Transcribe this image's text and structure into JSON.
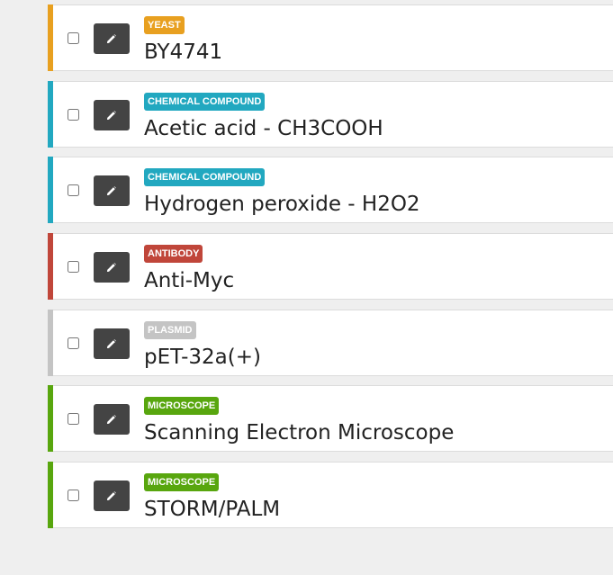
{
  "colors": {
    "yeast": "#e8a020",
    "chemical_compound": "#22a8c0",
    "antibody": "#c0463a",
    "plasmid": "#c4c4c4",
    "microscope": "#58a60e",
    "edit_button": "#444444"
  },
  "items": [
    {
      "category": "YEAST",
      "color": "#e8a020",
      "name": "BY4741",
      "checked": false,
      "edit_icon": "pencil-icon"
    },
    {
      "category": "CHEMICAL COMPOUND",
      "color": "#22a8c0",
      "name": "Acetic acid - CH3COOH",
      "checked": false,
      "edit_icon": "pencil-icon"
    },
    {
      "category": "CHEMICAL COMPOUND",
      "color": "#22a8c0",
      "name": "Hydrogen peroxide - H2O2",
      "checked": false,
      "edit_icon": "pencil-icon"
    },
    {
      "category": "ANTIBODY",
      "color": "#c0463a",
      "name": "Anti-Myc",
      "checked": false,
      "edit_icon": "pencil-icon"
    },
    {
      "category": "PLASMID",
      "color": "#c4c4c4",
      "name": "pET-32a(+)",
      "checked": false,
      "edit_icon": "pencil-icon"
    },
    {
      "category": "MICROSCOPE",
      "color": "#58a60e",
      "name": "Scanning Electron Microscope",
      "checked": false,
      "edit_icon": "pencil-icon"
    },
    {
      "category": "MICROSCOPE",
      "color": "#58a60e",
      "name": "STORM/PALM",
      "checked": false,
      "edit_icon": "pencil-icon"
    }
  ]
}
